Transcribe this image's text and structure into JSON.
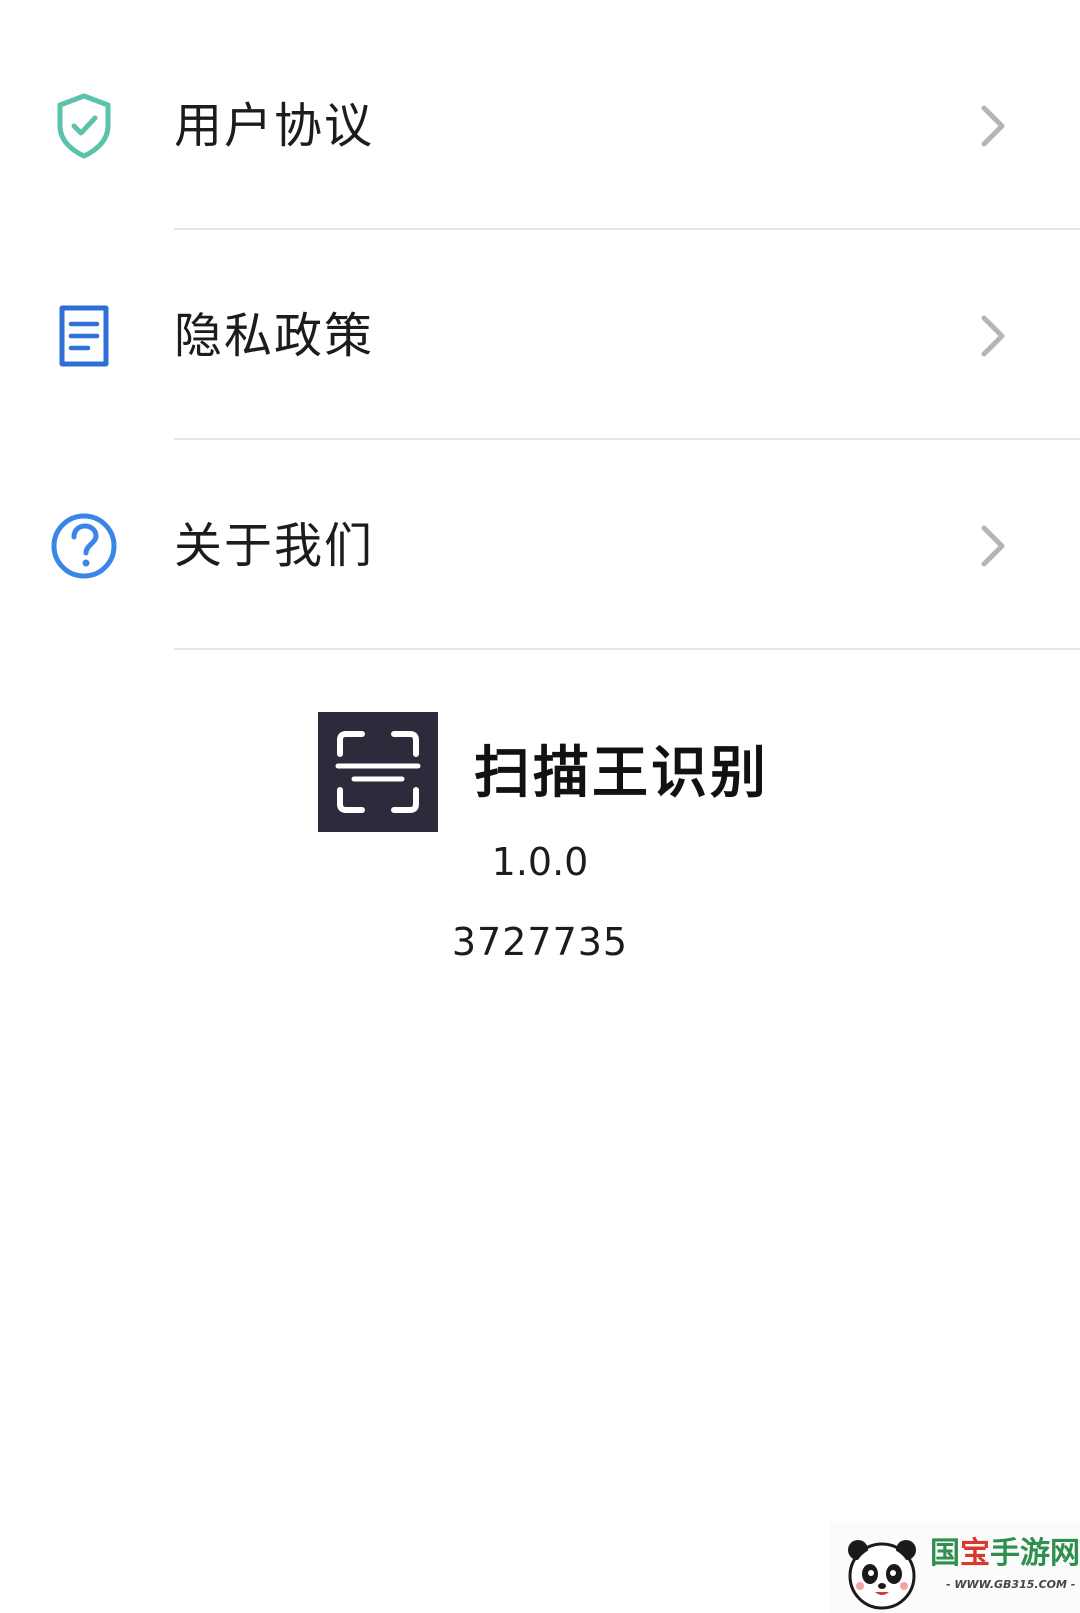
{
  "menu": {
    "items": [
      {
        "label": "用户协议",
        "icon": "shield-check-icon"
      },
      {
        "label": "隐私政策",
        "icon": "document-icon"
      },
      {
        "label": "关于我们",
        "icon": "question-circle-icon"
      }
    ]
  },
  "app_info": {
    "name": "扫描王识别",
    "version": "1.0.0",
    "build": "3727735",
    "logo_icon": "scan-frame-icon"
  },
  "watermark": {
    "logo_icon": "panda-logo-icon",
    "text_part1": "国",
    "text_part2": "宝",
    "text_part3": "手游网",
    "url": "- WWW.GB315.COM -"
  },
  "colors": {
    "shield": "#5cc3ab",
    "document": "#2f6fd6",
    "question": "#3a86e8",
    "chevron": "#b5b5b5",
    "divider": "#e4e4e4",
    "logo_bg": "#2c2a3b"
  }
}
